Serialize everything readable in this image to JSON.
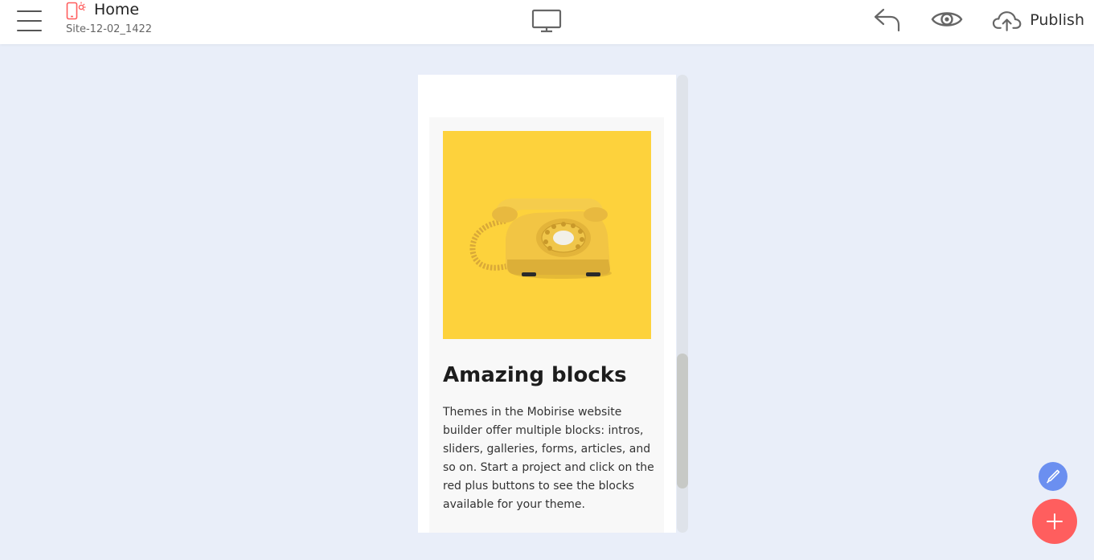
{
  "header": {
    "page_title": "Home",
    "site_name": "Site-12-02_1422",
    "publish_label": "Publish",
    "icons": {
      "menu": "hamburger-menu-icon",
      "site": "mobile-site-icon",
      "view_mode": "desktop-monitor-icon",
      "undo": "undo-arrow-icon",
      "preview": "eye-icon",
      "publish": "cloud-upload-icon"
    }
  },
  "preview": {
    "card": {
      "image": "yellow-rotary-telephone",
      "title": "Amazing blocks",
      "text": "Themes in the Mobirise website builder offer multiple blocks: intros, sliders, galleries, forms, articles, and so on. Start a project and click on the red plus buttons to see the blocks available for your theme."
    }
  },
  "fabs": {
    "edit": "pen-icon",
    "add": "plus-icon"
  },
  "colors": {
    "background": "#e9eef9",
    "image_background": "#fdd23c",
    "accent_red": "#ff5e5e",
    "accent_blue": "#6b8ff0"
  }
}
